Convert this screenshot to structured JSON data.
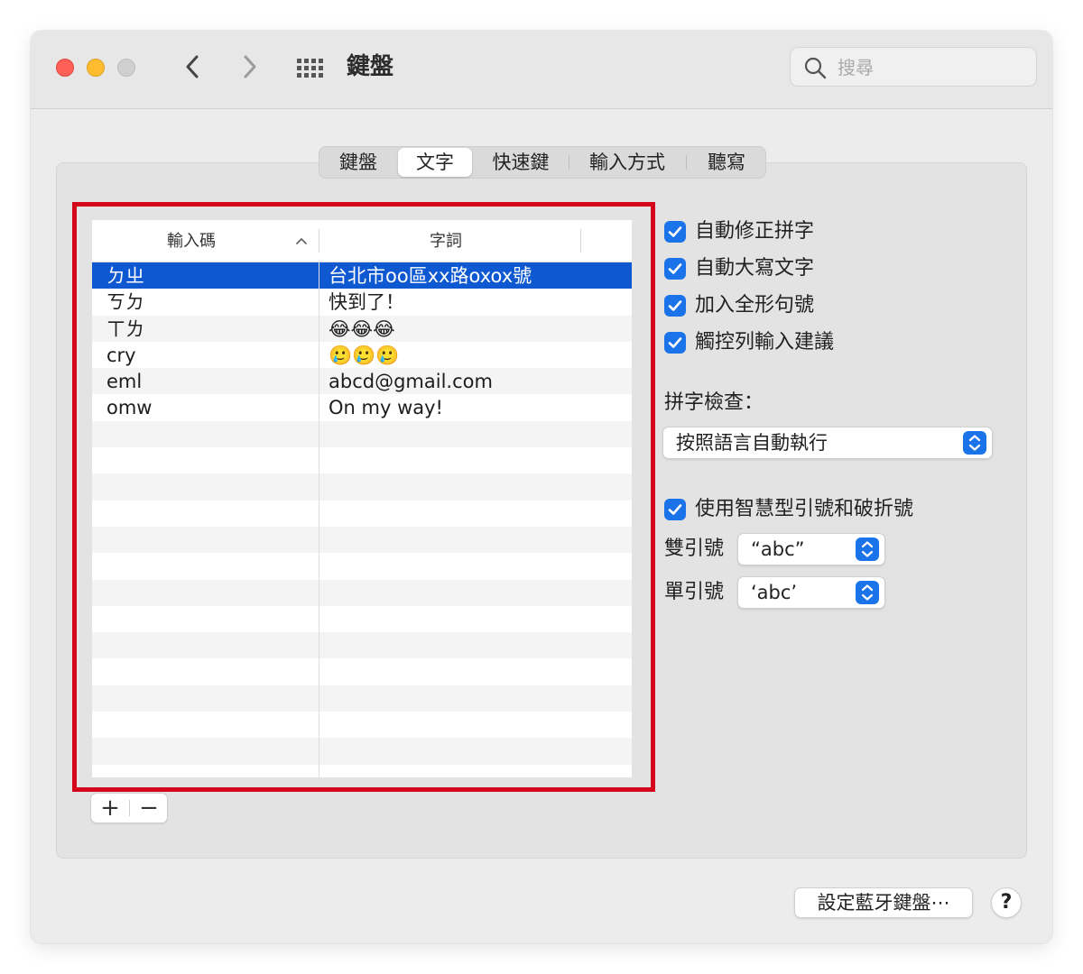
{
  "window": {
    "title": "鍵盤",
    "search_placeholder": "搜尋"
  },
  "tabs": [
    {
      "label": "鍵盤",
      "active": false
    },
    {
      "label": "文字",
      "active": true
    },
    {
      "label": "快速鍵",
      "active": false
    },
    {
      "label": "輸入方式",
      "active": false
    },
    {
      "label": "聽寫",
      "active": false
    }
  ],
  "table": {
    "columns": [
      "輸入碼",
      "字詞"
    ],
    "sort_column": "輸入碼",
    "sort_direction": "ascending",
    "rows": [
      {
        "code": "ㄉㄓ",
        "phrase": "台北市oo區xx路oxox號",
        "selected": true
      },
      {
        "code": "ㄎㄉ",
        "phrase": "快到了！",
        "selected": false
      },
      {
        "code": "ㄒㄌ",
        "phrase": "😂😂😂",
        "selected": false
      },
      {
        "code": "cry",
        "phrase": "🥲🥲🥲",
        "selected": false
      },
      {
        "code": "eml",
        "phrase": "abcd@gmail.com",
        "selected": false
      },
      {
        "code": "omw",
        "phrase": "On my way!",
        "selected": false
      }
    ]
  },
  "table_buttons": {
    "add": "+",
    "remove": "−"
  },
  "options": [
    {
      "label": "自動修正拼字",
      "checked": true
    },
    {
      "label": "自動大寫文字",
      "checked": true
    },
    {
      "label": "加入全形句號",
      "checked": true
    },
    {
      "label": "觸控列輸入建議",
      "checked": true
    }
  ],
  "spelling": {
    "label": "拼字檢查：",
    "value": "按照語言自動執行"
  },
  "smart_quotes": {
    "label": "使用智慧型引號和破折號",
    "checked": true,
    "double_label": "雙引號",
    "double_value": "“abc”",
    "single_label": "單引號",
    "single_value": "‘abc’"
  },
  "footer": {
    "bluetooth_button": "設定藍牙鍵盤⋯",
    "help": "?"
  },
  "colors": {
    "accent": "#1a73e8",
    "selection": "#0e59d1",
    "highlight_border": "#d3061c"
  }
}
